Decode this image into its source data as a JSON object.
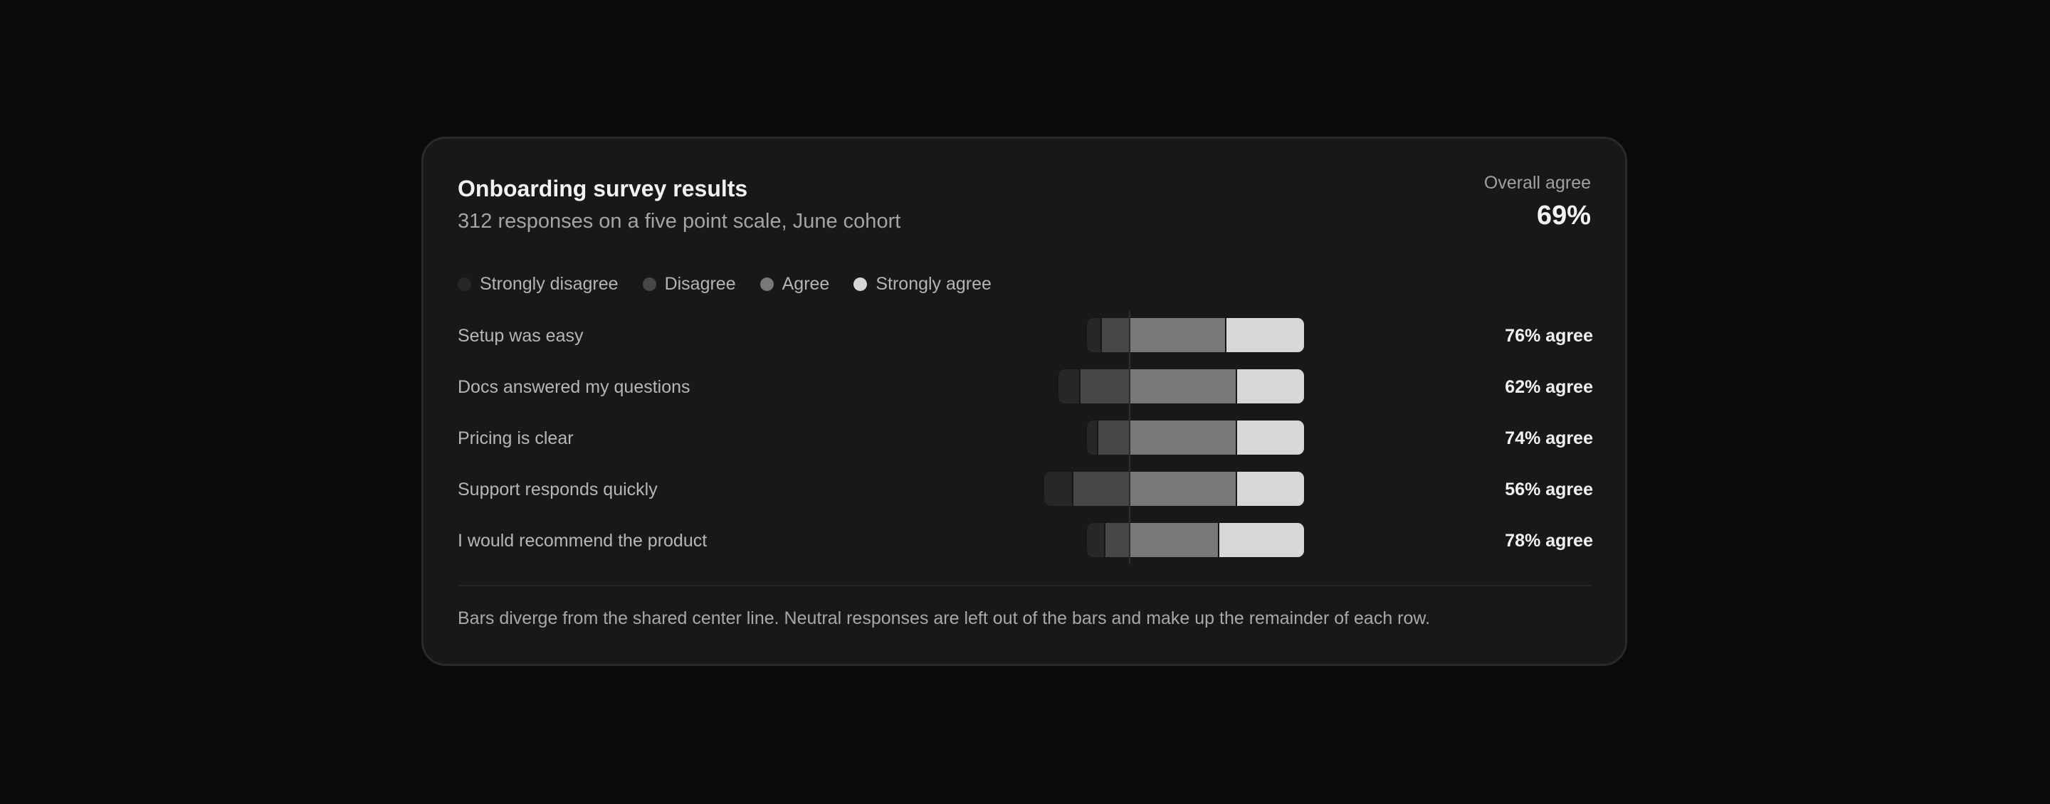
{
  "card": {
    "title": "Onboarding survey results",
    "subtitle": "312 responses on a five point scale, June cohort",
    "overall_label": "Overall agree",
    "overall_value": "69%",
    "footnote": "Bars diverge from the shared center line. Neutral responses are left out of the bars and make up the remainder of each row."
  },
  "colors": {
    "strongly_disagree": "#272727",
    "disagree": "#474747",
    "agree": "#787878",
    "strongly_agree": "#d7d7d7"
  },
  "chart_data": {
    "type": "bar",
    "orientation": "horizontal",
    "stacking": "diverging",
    "legend_position": "top-left",
    "legend": [
      "Strongly disagree",
      "Disagree",
      "Agree",
      "Strongly agree"
    ],
    "categories": [
      "Setup was easy",
      "Docs answered my questions",
      "Pricing is clear",
      "Support responds quickly",
      "I would recommend the product"
    ],
    "series": [
      {
        "name": "Strongly disagree",
        "side": "negative",
        "values": [
          4,
          6,
          3,
          8,
          5
        ]
      },
      {
        "name": "Disagree",
        "side": "negative",
        "values": [
          8,
          14,
          9,
          16,
          7
        ]
      },
      {
        "name": "Agree",
        "side": "positive",
        "values": [
          27,
          30,
          30,
          30,
          25
        ]
      },
      {
        "name": "Strongly agree",
        "side": "positive",
        "values": [
          22,
          19,
          19,
          19,
          24
        ]
      }
    ],
    "row_labels": [
      "76% agree",
      "62% agree",
      "74% agree",
      "56% agree",
      "78% agree"
    ]
  }
}
